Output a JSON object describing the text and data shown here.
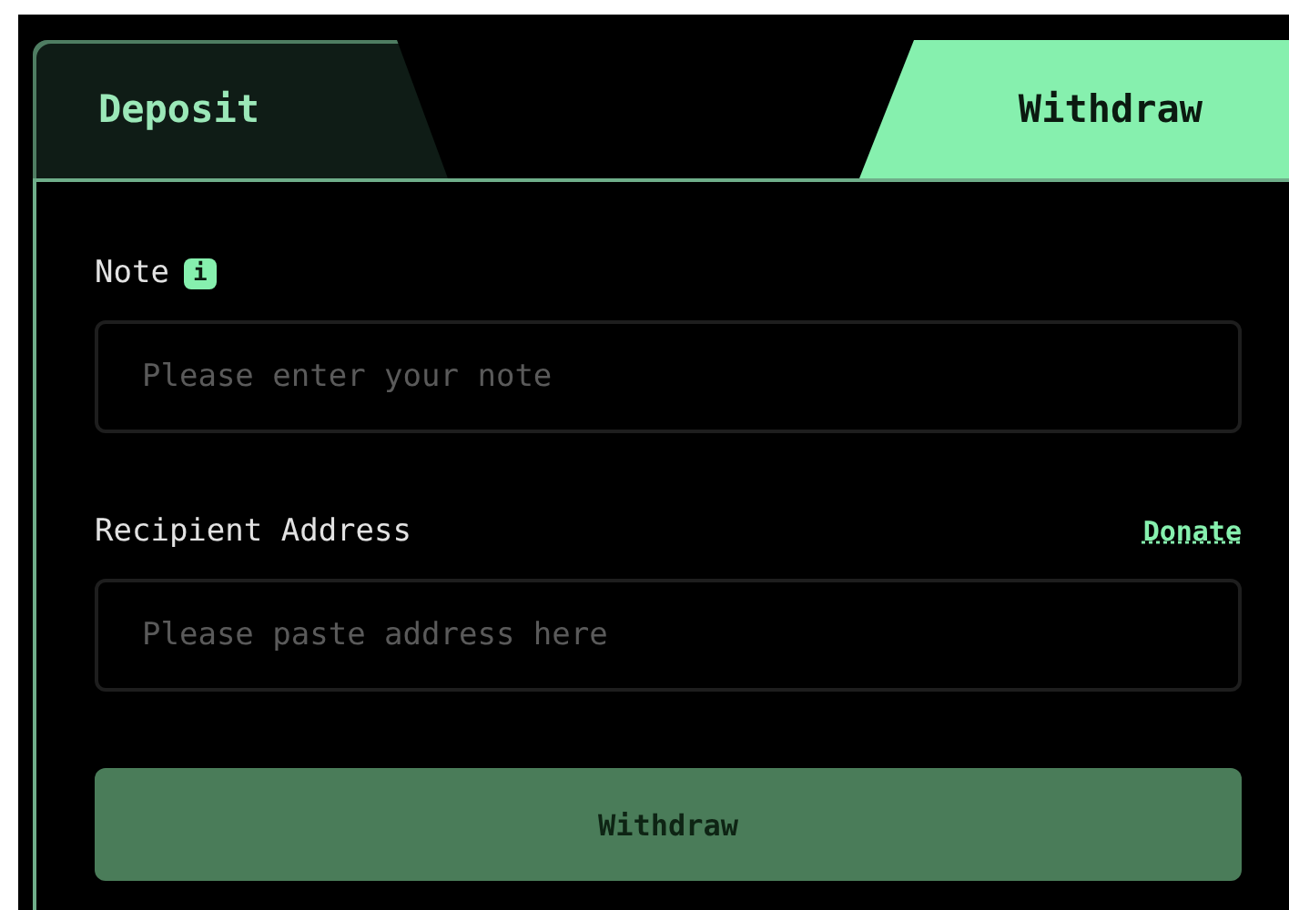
{
  "tabs": [
    {
      "label": "Deposit",
      "selected": false
    },
    {
      "label": "Withdraw",
      "selected": true
    }
  ],
  "note": {
    "label": "Note",
    "info": "i",
    "placeholder": "Please enter your note"
  },
  "recipient": {
    "label": "Recipient Address",
    "link": "Donate",
    "placeholder": "Please paste address here"
  },
  "submit": {
    "label": "Withdraw",
    "disabled": true
  }
}
